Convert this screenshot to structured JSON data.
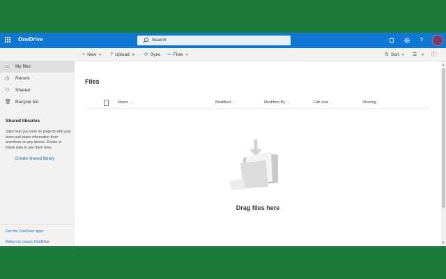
{
  "topbar": {
    "app_name": "OneDrive",
    "search_placeholder": "Search",
    "icons": [
      "waffle-icon",
      "search-icon",
      "notification-icon",
      "gear-icon",
      "help-icon",
      "avatar"
    ],
    "accent": "#0f78d4"
  },
  "commands": {
    "new": "New",
    "upload": "Upload",
    "sync": "Sync",
    "flow": "Flow",
    "sort": "Sort"
  },
  "sidebar": {
    "items": [
      {
        "label": "My files",
        "icon": "folder-icon",
        "active": true
      },
      {
        "label": "Recent",
        "icon": "clock-icon",
        "active": false
      },
      {
        "label": "Shared",
        "icon": "people-icon",
        "active": false
      },
      {
        "label": "Recycle bin",
        "icon": "trash-icon",
        "active": false
      }
    ],
    "shared_heading": "Shared libraries",
    "shared_text": "Sites help you work on projects with your team and share information from anywhere on any device. Create or follow sites to see them here.",
    "create_link": "Create shared library",
    "get_apps": "Get the OneDrive apps",
    "classic": "Return to classic OneDrive"
  },
  "main": {
    "title": "Files",
    "columns": [
      "Name",
      "Modified",
      "Modified By",
      "File size",
      "Sharing"
    ],
    "empty_text": "Drag files here"
  }
}
